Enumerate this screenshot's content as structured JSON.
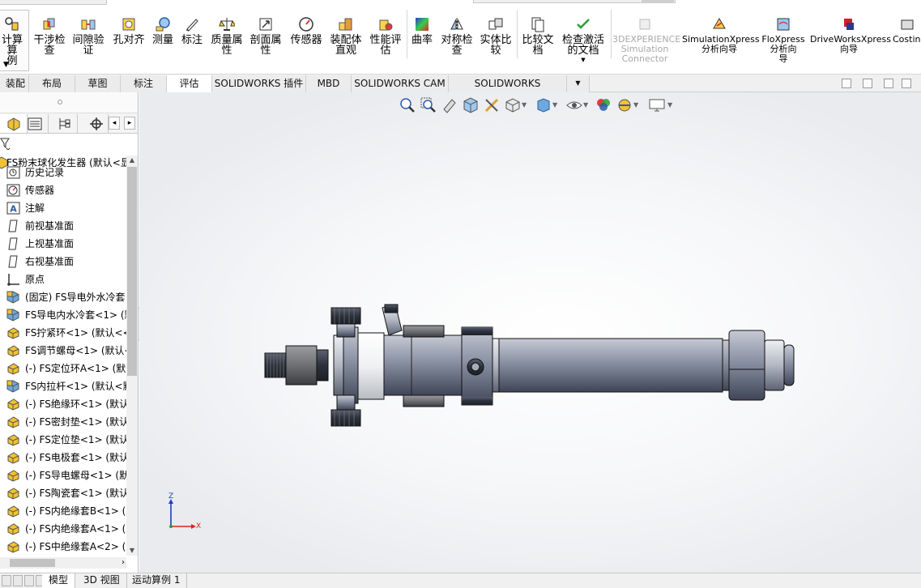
{
  "ribbon": {
    "buttons": [
      {
        "label": "计算算\n例",
        "icon": "design-study-icon"
      },
      {
        "label": "干涉检\n查",
        "icon": "interference-check-icon"
      },
      {
        "label": "间隙验\n证",
        "icon": "clearance-verify-icon"
      },
      {
        "label": "孔对齐",
        "icon": "hole-alignment-icon"
      },
      {
        "label": "测量",
        "icon": "measure-icon"
      },
      {
        "label": "标注",
        "icon": "markup-icon"
      },
      {
        "label": "质量属\n性",
        "icon": "mass-properties-icon"
      },
      {
        "label": "剖面属\n性",
        "icon": "section-properties-icon"
      },
      {
        "label": "传感器",
        "icon": "sensor-icon"
      },
      {
        "label": "装配体\n直观",
        "icon": "assembly-visualization-icon"
      },
      {
        "label": "性能评\n估",
        "icon": "performance-evaluation-icon"
      },
      {
        "label": "曲率",
        "icon": "curvature-icon"
      },
      {
        "label": "对称检\n查",
        "icon": "symmetry-check-icon"
      },
      {
        "label": "实体比\n较",
        "icon": "compare-bodies-icon"
      },
      {
        "label": "比较文\n档",
        "icon": "compare-documents-icon"
      },
      {
        "label": "检查激活\n的文档",
        "icon": "check-active-document-icon"
      },
      {
        "label": "3DEXPERIENCE\nSimulation\nConnector",
        "icon": "3dexperience-icon"
      },
      {
        "label": "SimulationXpress\n分析向导",
        "icon": "simulationxpress-icon"
      },
      {
        "label": "FloXpress\n分析向\n导",
        "icon": "floxpress-icon"
      },
      {
        "label": "DriveWorksXpress\n向导",
        "icon": "driveworksxpress-icon"
      },
      {
        "label": "Costin",
        "icon": "costing-icon"
      }
    ]
  },
  "tabs": [
    "装配体",
    "布局",
    "草图",
    "标注",
    "评估",
    "SOLIDWORKS 插件",
    "MBD",
    "SOLIDWORKS CAM",
    "SOLIDWORKS Inspection"
  ],
  "active_tab": "评估",
  "tree": {
    "root": "FS粉末球化发生器 (默认<显",
    "items": [
      {
        "label": "历史记录",
        "icon": "history-icon"
      },
      {
        "label": "传感器",
        "icon": "sensor-folder-icon"
      },
      {
        "label": "注解",
        "icon": "annotations-icon"
      },
      {
        "label": "前视基准面",
        "icon": "plane-icon"
      },
      {
        "label": "上视基准面",
        "icon": "plane-icon"
      },
      {
        "label": "右视基准面",
        "icon": "plane-icon"
      },
      {
        "label": "原点",
        "icon": "origin-icon"
      },
      {
        "label": "(固定) FS导电外水冷套",
        "icon": "subassembly-icon"
      },
      {
        "label": "FS导电内水冷套<1> (默",
        "icon": "subassembly-icon"
      },
      {
        "label": "FS拧紧环<1> (默认<<",
        "icon": "part-icon"
      },
      {
        "label": "FS调节螺母<1> (默认<",
        "icon": "part-icon"
      },
      {
        "label": "(-) FS定位环A<1> (默认",
        "icon": "part-icon"
      },
      {
        "label": "FS内拉杆<1> (默认<默",
        "icon": "subassembly-icon"
      },
      {
        "label": "(-) FS绝缘环<1> (默认",
        "icon": "part-icon"
      },
      {
        "label": "(-) FS密封垫<1> (默认",
        "icon": "part-icon"
      },
      {
        "label": "(-) FS定位垫<1> (默认",
        "icon": "part-icon"
      },
      {
        "label": "(-) FS电极套<1> (默认",
        "icon": "part-icon"
      },
      {
        "label": "(-) FS导电螺母<1> (默",
        "icon": "part-icon"
      },
      {
        "label": "(-) FS陶瓷套<1> (默认",
        "icon": "part-icon"
      },
      {
        "label": "(-) FS内绝缘套B<1> (默",
        "icon": "part-icon"
      },
      {
        "label": "(-) FS内绝缘套A<1> (默",
        "icon": "part-icon"
      },
      {
        "label": "(-) FS中绝缘套A<2> (默",
        "icon": "part-icon"
      }
    ]
  },
  "triad": {
    "z": "Z",
    "x": "X"
  },
  "bottom_tabs": [
    "模型",
    "3D 视图",
    "运动算例 1"
  ],
  "active_bottom_tab": "模型",
  "colors": {
    "accent": "#0f6ac4",
    "part_yellow": "#f2c230",
    "part_blue": "#6fa8dc",
    "model_body": "#8e96a8"
  }
}
